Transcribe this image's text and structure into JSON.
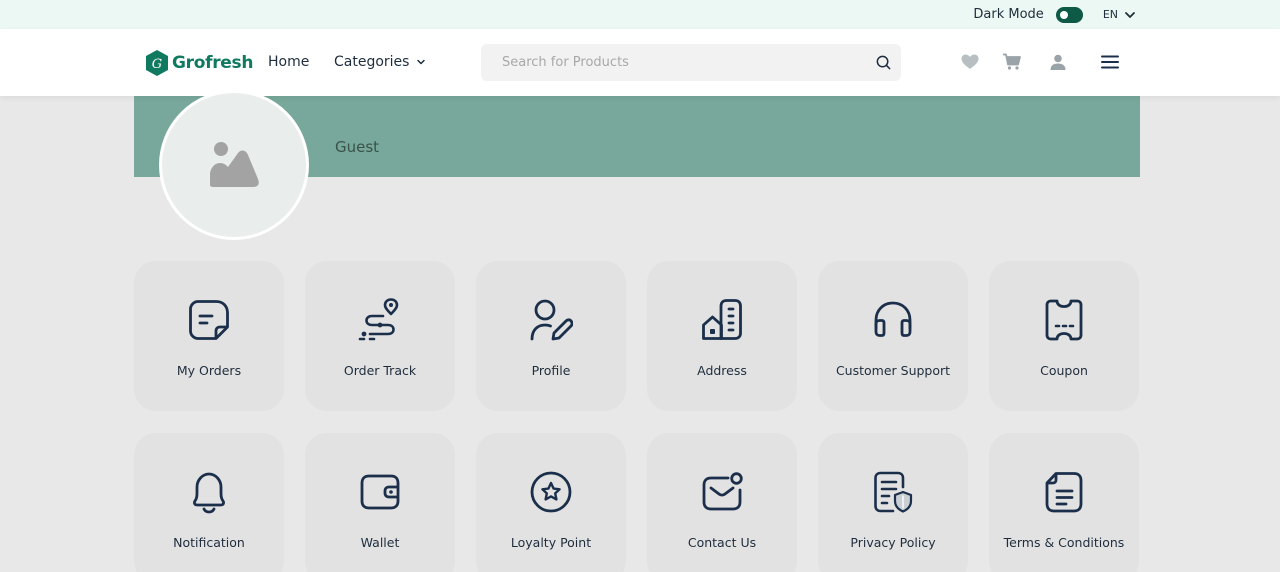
{
  "topbar": {
    "dark_mode_label": "Dark Mode",
    "language": "EN"
  },
  "header": {
    "brand": "Grofresh",
    "nav_home": "Home",
    "nav_categories": "Categories",
    "search_placeholder": "Search for Products"
  },
  "profile": {
    "name": "Guest"
  },
  "menu": [
    {
      "label": "My Orders",
      "icon": "orders-icon"
    },
    {
      "label": "Order Track",
      "icon": "order-track-icon"
    },
    {
      "label": "Profile",
      "icon": "profile-edit-icon"
    },
    {
      "label": "Address",
      "icon": "address-icon"
    },
    {
      "label": "Customer Support",
      "icon": "headset-icon"
    },
    {
      "label": "Coupon",
      "icon": "coupon-icon"
    },
    {
      "label": "Notification",
      "icon": "bell-icon"
    },
    {
      "label": "Wallet",
      "icon": "wallet-icon"
    },
    {
      "label": "Loyalty Point",
      "icon": "star-circle-icon"
    },
    {
      "label": "Contact Us",
      "icon": "mail-icon"
    },
    {
      "label": "Privacy Policy",
      "icon": "privacy-shield-icon"
    },
    {
      "label": "Terms & Conditions",
      "icon": "document-icon"
    }
  ],
  "colors": {
    "brand": "#0f7a5f",
    "banner": "#78a89b",
    "icon": "#1b2f4b"
  }
}
